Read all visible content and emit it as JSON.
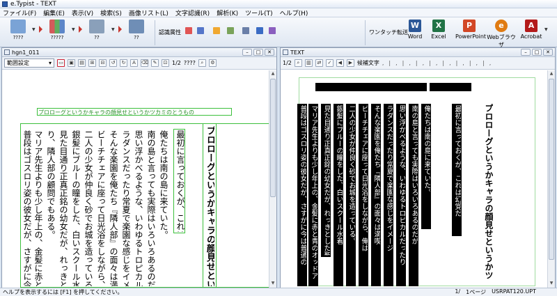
{
  "window": {
    "title": "e.Typist - TEXT"
  },
  "menu": [
    "ファイル(F)",
    "編集(E)",
    "表示(V)",
    "検索(S)",
    "画像リスト(L)",
    "文字認識(R)",
    "解析(K)",
    "ツール(T)",
    "ヘルプ(H)"
  ],
  "toolbar": {
    "big_buttons": [
      {
        "label": "????",
        "color": "#7aa3d6"
      },
      {
        "label": "?????",
        "color": "#d35b5b"
      },
      {
        "label": "??",
        "color": "#8aa0ba"
      },
      {
        "label": "??",
        "color": "#6f8eb6"
      }
    ],
    "ninshiki_label": "認識属性",
    "oneshot_label": "ワンタッチ転送",
    "apps": [
      {
        "label": "Word",
        "icon": "W",
        "color": "#2b5797"
      },
      {
        "label": "Excel",
        "icon": "X",
        "color": "#217346"
      },
      {
        "label": "PowerPoint",
        "icon": "P",
        "color": "#d24726"
      },
      {
        "label": "Webブラウザ",
        "icon": "e",
        "color": "#e07b12"
      },
      {
        "label": "Acrobat",
        "icon": "A",
        "color": "#b31a1a"
      }
    ]
  },
  "left_pane": {
    "title": "hgn1_011",
    "select_value": "範囲設定",
    "page_counter": "1/2",
    "zoom": "????",
    "green_title": "プロローグというかキャラの顔見せというかツカミのとうもの",
    "columns": [
      {
        "text": "プロローグというかキャラの顔見せというかツカ",
        "bold": true
      },
      {
        "text": "最初に言っておくが、これは幻覚だ",
        "bold": false,
        "green": true
      },
      {
        "text": "俺たちは南の島に来ていた。",
        "bold": false
      },
      {
        "text": "南の島と言っても実際はいろいろあるのだが、まあそ",
        "bold": false
      },
      {
        "text": "思い浮かべるような、いわゆるトロピカルだったり綺麗",
        "bold": false
      },
      {
        "text": "ラダンスだったり常夏で楽園な感じをイメージしてもら",
        "bold": false
      },
      {
        "text": "そんな楽園を俺たち『隣人部』の面々は満喫していた",
        "bold": false
      },
      {
        "text": "ビーチチェアに座って日光浴をしながら、俺は浜辺の",
        "bold": false
      },
      {
        "text": "二人の少女が仲良く砂でお城を造っている。",
        "bold": false
      },
      {
        "text": "銀髪にブルーの瞳をした、白いスクール水着を着た",
        "bold": false
      },
      {
        "text": "見た目通り正真正銘の幼女だが、れっきとした聖クロ",
        "bold": false
      },
      {
        "text": "り、隣人部の顧問でもある。",
        "bold": false
      },
      {
        "text": "マリア先生よりも少し年上の、金髪に赤と青のオッドア",
        "bold": false
      },
      {
        "text": "普段はゴスロリ姿の彼女だが、さすがに今は普通の",
        "bold": false
      }
    ]
  },
  "right_pane": {
    "title": "TEXT",
    "page_counter": "1/2",
    "kouho_label": "候補文字",
    "columns": [
      "プロローグというかキャラの顔見せというかツ",
      "最初に言っておくが、これは幻覚だ",
      "俺たちは南の島に来ていた。",
      "南の島と言っても実際はいろいろあるのだが",
      "思い浮かべるような、いわゆるトロピカルだったり",
      "ラダンスだったり常夏で楽園な感じをイメージ",
      "そんな楽園を俺たち『隣人部』の面々は満喫",
      "ビーチチェアに座って日光浴をしながら、俺は",
      "二人の少女が仲良く砂でお城を造っている。",
      "銀髪にブルーの瞳をした、白いスクール水着",
      "見た目通り正真正銘の幼女だが、れっきとした聖クロ",
      "り、隣人部の顧問でもある。",
      "マリア先生よりも少し年上の、金髪に赤と青のオッドア",
      "普段はゴスロリ姿の彼女だが、さすがに今は普通の"
    ]
  },
  "status": {
    "help_text": "ヘルプを表示するには [F1] を押してください。",
    "page": "1/",
    "pages": "1ページ",
    "file": "USRPAT120.UPT"
  },
  "colors": {
    "green_frame": "#3bbf3b",
    "accent_red": "#c8352d"
  }
}
